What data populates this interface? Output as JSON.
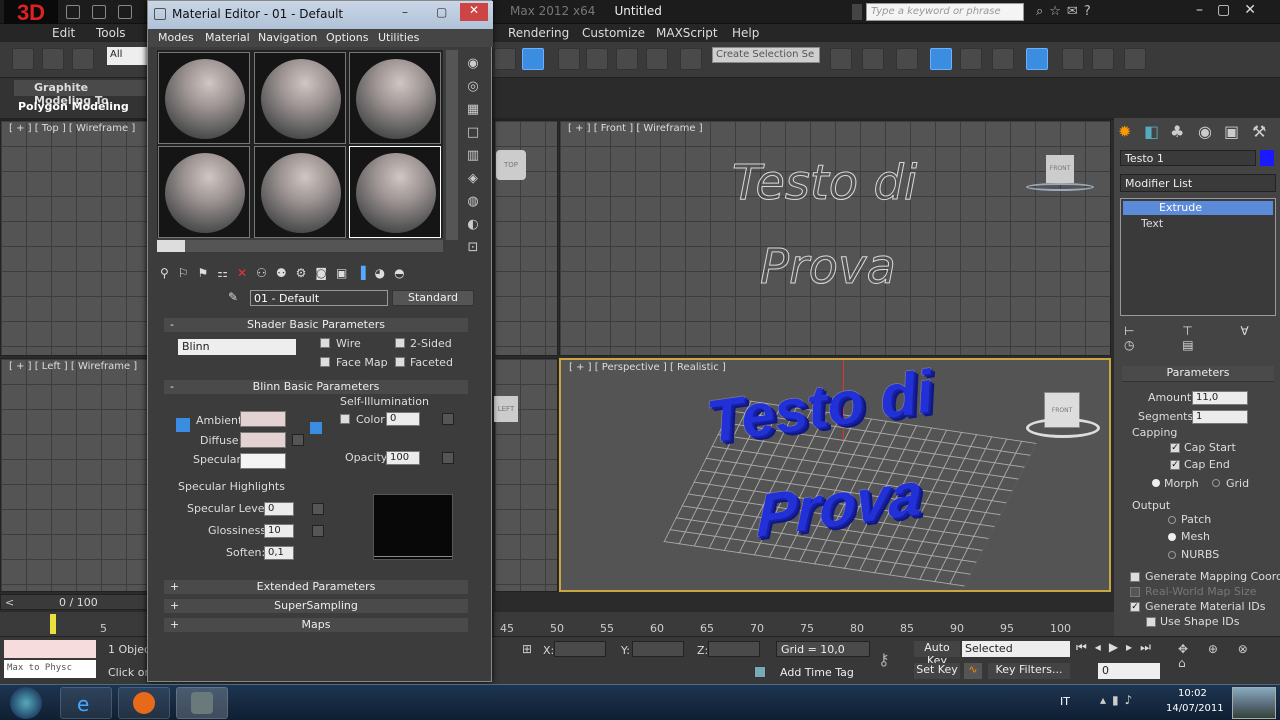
{
  "app": {
    "logo": "3D",
    "title_dim": "Max 2012 x64",
    "title": "Untitled",
    "search_placeholder": "Type a keyword or phrase"
  },
  "menubar": [
    "Edit",
    "Tools",
    "Rendering",
    "Customize",
    "MAXScript",
    "Help"
  ],
  "toolbar": {
    "filter": "All",
    "selection_set": "Create Selection Se"
  },
  "ribbon": {
    "tab": "Graphite Modeling To",
    "panel": "Polygon Modeling"
  },
  "viewports": {
    "top": "[ + ] [ Top ] [ Wireframe ]",
    "front": "[ + ] [ Front ] [ Wireframe ]",
    "left": "[ + ] [ Left ] [ Wireframe ]",
    "perspective": "[ + ] [ Perspective ] [ Realistic ]",
    "text_line1": "Testo di",
    "text_line2": "Prova",
    "cube_top": "TOP",
    "cube_front": "FRONT",
    "cube_left": "LEFT"
  },
  "material_editor": {
    "title": "Material Editor - 01 - Default",
    "menu": [
      "Modes",
      "Material",
      "Navigation",
      "Options",
      "Utilities"
    ],
    "material_name": "01 - Default",
    "material_type": "Standard",
    "shader_rollout": "Shader Basic Parameters",
    "shader": "Blinn",
    "wire": "Wire",
    "two_sided": "2-Sided",
    "face_map": "Face Map",
    "faceted": "Faceted",
    "blinn_rollout": "Blinn Basic Parameters",
    "self_illum": "Self-Illumination",
    "ambient": "Ambient:",
    "diffuse": "Diffuse:",
    "specular": "Specular:",
    "color": "Color",
    "color_value": "0",
    "opacity": "Opacity:",
    "opacity_value": "100",
    "spec_highlights": "Specular Highlights",
    "spec_level": "Specular Level:",
    "spec_level_value": "0",
    "glossiness": "Glossiness:",
    "glossiness_value": "10",
    "soften": "Soften:",
    "soften_value": "0,1",
    "extended": "Extended Parameters",
    "supersampling": "SuperSampling",
    "maps": "Maps",
    "plus": "+",
    "minus": "-"
  },
  "command_panel": {
    "object_name": "Testo 1",
    "modifier_list": "Modifier List",
    "stack": [
      "Extrude",
      "Text"
    ],
    "parameters": "Parameters",
    "amount_label": "Amount:",
    "amount": "11,0",
    "segments_label": "Segments:",
    "segments": "1",
    "capping": "Capping",
    "cap_start": "Cap Start",
    "cap_end": "Cap End",
    "morph": "Morph",
    "grid": "Grid",
    "output": "Output",
    "patch": "Patch",
    "mesh": "Mesh",
    "nurbs": "NURBS",
    "gen_map": "Generate Mapping Coords.",
    "real_world": "Real-World Map Size",
    "gen_mat": "Generate Material IDs",
    "use_shape": "Use Shape IDs"
  },
  "timeline": {
    "frame": "0 / 100",
    "ticks": [
      "5",
      "45",
      "50",
      "55",
      "60",
      "65",
      "70",
      "75",
      "80",
      "85",
      "90",
      "95",
      "100"
    ]
  },
  "status": {
    "objects": "1 Objec",
    "click": "Click or",
    "maxscript": "Max to Physc",
    "x": "X:",
    "y": "Y:",
    "z": "Z:",
    "grid": "Grid = 10,0",
    "add_time_tag": "Add Time Tag",
    "auto_key": "Auto Key",
    "selected": "Selected",
    "set_key": "Set Key",
    "key_filters": "Key Filters...",
    "frame_field": "0"
  },
  "taskbar": {
    "lang": "IT",
    "time": "10:02",
    "date": "14/07/2011"
  }
}
